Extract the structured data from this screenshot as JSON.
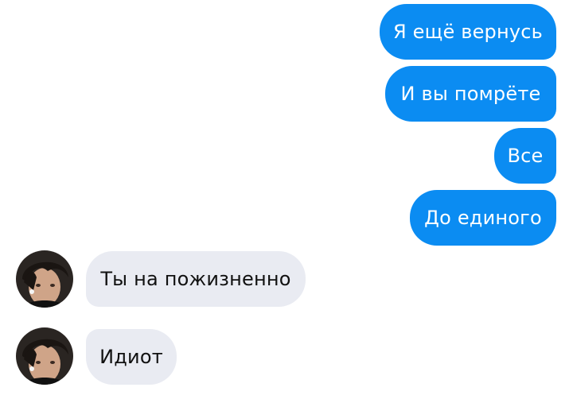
{
  "messages": [
    {
      "direction": "outgoing",
      "text": "Я ещё вернусь"
    },
    {
      "direction": "outgoing",
      "text": "И вы помрёте"
    },
    {
      "direction": "outgoing",
      "text": "Все"
    },
    {
      "direction": "outgoing",
      "text": "До единого"
    },
    {
      "direction": "incoming",
      "text": "Ты на пожизненно"
    },
    {
      "direction": "incoming",
      "text": "Идиот"
    }
  ],
  "colors": {
    "outgoing_bubble": "#0b8cf2",
    "incoming_bubble": "#e9ebf2",
    "background": "#ffffff"
  },
  "avatar_icon": "contact-photo-avatar"
}
